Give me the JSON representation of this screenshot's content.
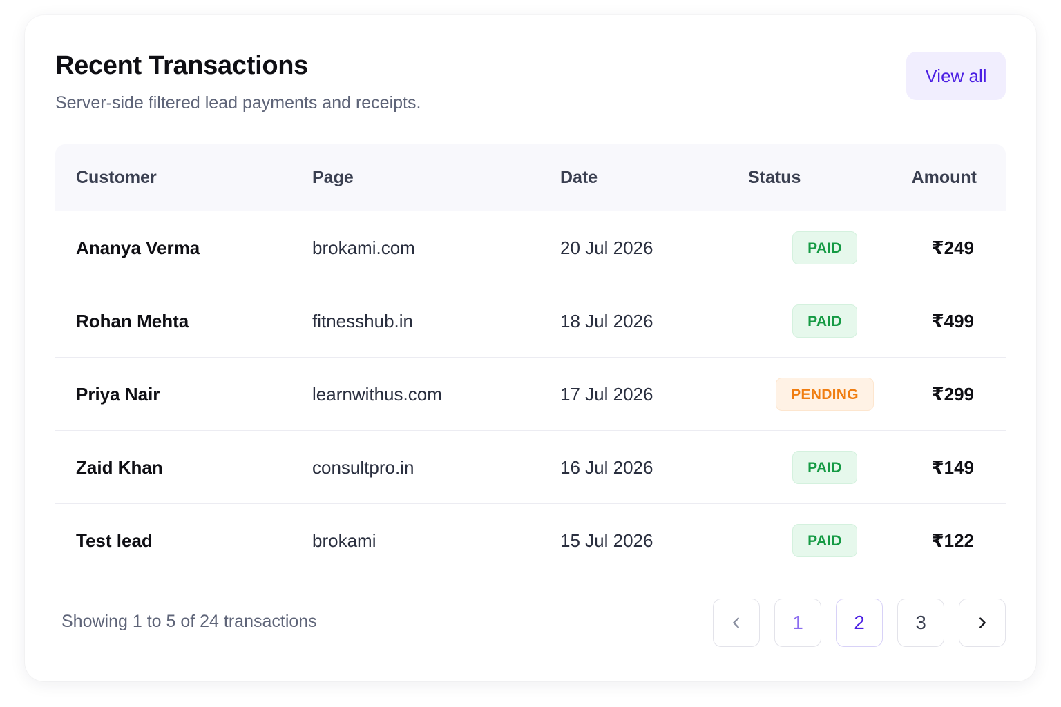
{
  "header": {
    "title": "Recent Transactions",
    "subtitle": "Server-side filtered lead payments and receipts.",
    "view_all_label": "View all"
  },
  "table": {
    "columns": [
      "Customer",
      "Page",
      "Date",
      "Status",
      "Amount"
    ],
    "rows": [
      {
        "customer": "Ananya Verma",
        "page": "brokami.com",
        "date": "20 Jul 2026",
        "status": "PAID",
        "amount": "₹249"
      },
      {
        "customer": "Rohan Mehta",
        "page": "fitnesshub.in",
        "date": "18 Jul 2026",
        "status": "PAID",
        "amount": "₹499"
      },
      {
        "customer": "Priya Nair",
        "page": "learnwithus.com",
        "date": "17 Jul 2026",
        "status": "PENDING",
        "amount": "₹299"
      },
      {
        "customer": "Zaid Khan",
        "page": "consultpro.in",
        "date": "16 Jul 2026",
        "status": "PAID",
        "amount": "₹149"
      },
      {
        "customer": "Test lead",
        "page": "brokami",
        "date": "15 Jul 2026",
        "status": "PAID",
        "amount": "₹122"
      }
    ]
  },
  "footer": {
    "summary": "Showing 1 to 5 of 24 transactions",
    "pages": [
      "1",
      "2",
      "3"
    ],
    "active_page": "2"
  },
  "icons": {
    "prev": "chevron-left-icon",
    "next": "chevron-right-icon"
  },
  "colors": {
    "accent": "#4b1fe3",
    "paid_text": "#159a44",
    "paid_bg": "#e6f8ec",
    "pending_text": "#f07d10",
    "pending_bg": "#fff2e5"
  }
}
